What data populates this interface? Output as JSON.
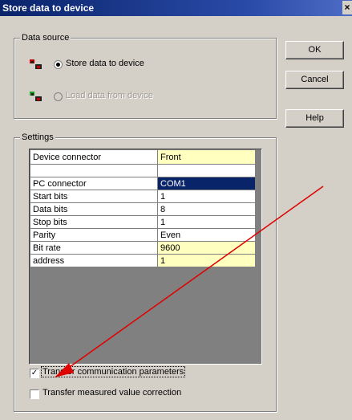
{
  "window": {
    "title": "Store data to device",
    "close_glyph": "×"
  },
  "data_source": {
    "legend": "Data source",
    "options": [
      {
        "label": "Store data to device",
        "selected": true,
        "enabled": true
      },
      {
        "label": "Load data from device",
        "selected": false,
        "enabled": false
      }
    ]
  },
  "settings": {
    "legend": "Settings",
    "rows": [
      {
        "key": "Device connector",
        "value": "Front",
        "style": "yellow"
      },
      {
        "key": "",
        "value": "",
        "style": "plain"
      },
      {
        "key": "PC connector",
        "value": "COM1",
        "style": "selected"
      },
      {
        "key": "Start bits",
        "value": "1",
        "style": "plain"
      },
      {
        "key": "Data bits",
        "value": "8",
        "style": "plain"
      },
      {
        "key": "Stop bits",
        "value": "1",
        "style": "plain"
      },
      {
        "key": "Parity",
        "value": "Even",
        "style": "plain"
      },
      {
        "key": "Bit rate",
        "value": "9600",
        "style": "yellow"
      },
      {
        "key": "address",
        "value": "1",
        "style": "yellow"
      }
    ]
  },
  "checkboxes": [
    {
      "label": "Transfer communication parameters",
      "checked": true,
      "check_glyph": "✓"
    },
    {
      "label": "Transfer measured value correction",
      "checked": false,
      "check_glyph": ""
    }
  ],
  "buttons": {
    "ok": "OK",
    "cancel": "Cancel",
    "help": "Help"
  },
  "colors": {
    "annotation_arrow": "#e00000",
    "title_bar": "#0a246a",
    "highlight_cell": "#ffffc0"
  }
}
